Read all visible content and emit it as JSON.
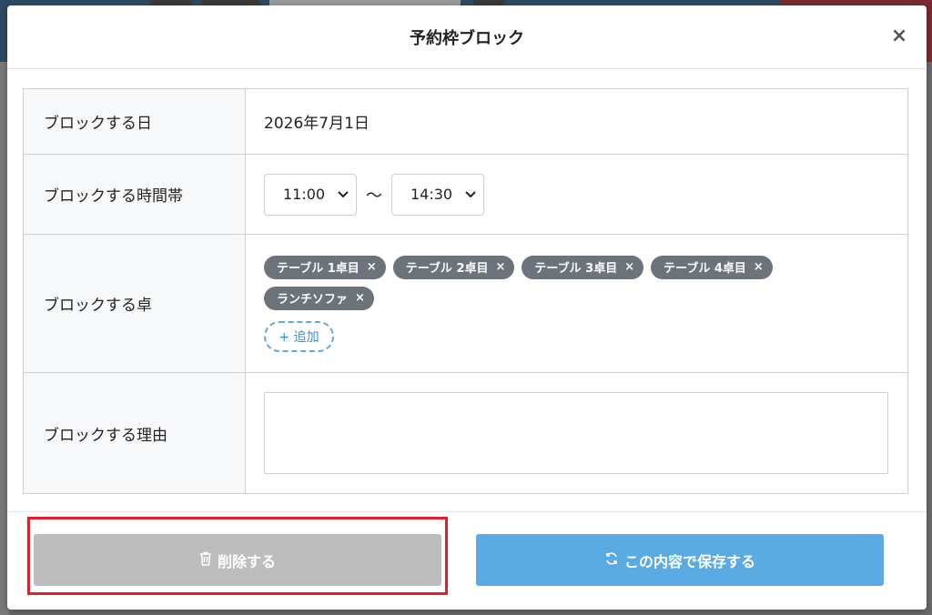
{
  "modal": {
    "title": "予約枠ブロック",
    "close_glyph": "×"
  },
  "form": {
    "date_label": "ブロックする日",
    "date_value": "2026年7月1日",
    "time_label": "ブロックする時間帯",
    "time_start": "11:00",
    "time_end": "14:30",
    "time_separator": "〜",
    "tables_label": "ブロックする卓",
    "tables": [
      "テーブル 1卓目",
      "テーブル 2卓目",
      "テーブル 3卓目",
      "テーブル 4卓目",
      "ランチソファ"
    ],
    "tag_remove_glyph": "×",
    "add_label": "+ 追加",
    "reason_label": "ブロックする理由",
    "reason_value": ""
  },
  "footer": {
    "delete_label": "削除する",
    "save_label": "この内容で保存する"
  },
  "icons": {
    "delete": "trash-icon",
    "save": "refresh-icon",
    "close": "close-icon",
    "select": "chevron-down-icon"
  },
  "colors": {
    "delete_bg": "#bdbdbd",
    "save_bg": "#5aabe3",
    "tag_bg": "#6c737a",
    "highlight": "#e3202a"
  }
}
